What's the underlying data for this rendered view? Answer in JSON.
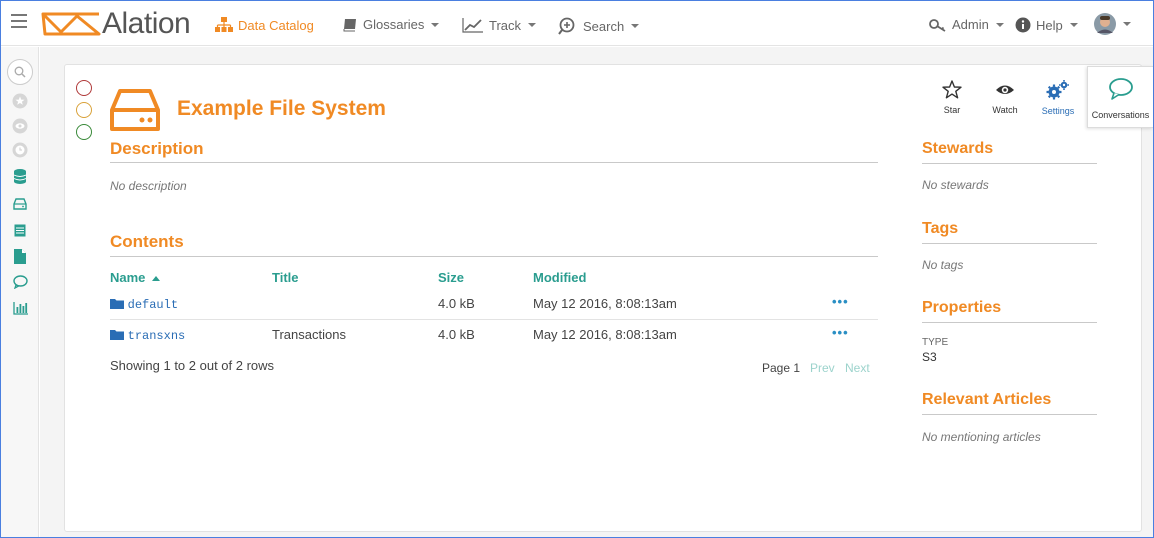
{
  "app": {
    "name": "Alation"
  },
  "nav": {
    "data_catalog": "Data Catalog",
    "glossaries": "Glossaries",
    "track": "Track",
    "search": "Search",
    "admin": "Admin",
    "help": "Help"
  },
  "page": {
    "title": "Example File System"
  },
  "description": {
    "heading": "Description",
    "text": "No description"
  },
  "contents": {
    "heading": "Contents",
    "columns": {
      "name": "Name",
      "title": "Title",
      "size": "Size",
      "modified": "Modified"
    },
    "rows": [
      {
        "name": "default",
        "title": "",
        "size": "4.0 kB",
        "modified": "May 12 2016, 8:08:13am"
      },
      {
        "name": "transxns",
        "title": "Transactions",
        "size": "4.0 kB",
        "modified": "May 12 2016, 8:08:13am"
      }
    ],
    "row_menu": "•••",
    "summary": "Showing 1 to 2 out of 2 rows",
    "pager": {
      "page": "Page 1",
      "prev": "Prev",
      "next": "Next"
    }
  },
  "actions": {
    "star": "Star",
    "watch": "Watch",
    "settings": "Settings",
    "conversations": "Conversations"
  },
  "sidebar": {
    "stewards": {
      "heading": "Stewards",
      "text": "No stewards"
    },
    "tags": {
      "heading": "Tags",
      "text": "No tags"
    },
    "properties": {
      "heading": "Properties",
      "key": "TYPE",
      "value": "S3"
    },
    "articles": {
      "heading": "Relevant Articles",
      "text": "No mentioning articles"
    }
  },
  "colors": {
    "brand_orange": "#f08a24",
    "teal": "#2a9d8f",
    "link_blue": "#2a6db5"
  }
}
